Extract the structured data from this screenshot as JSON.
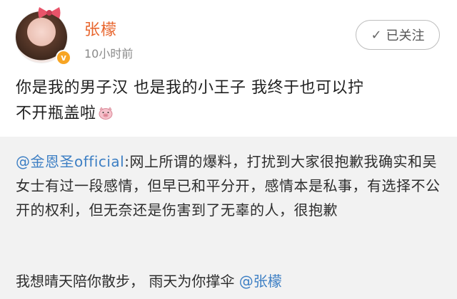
{
  "post": {
    "username": "张檬",
    "time": "10小时前",
    "follow_label": "已关注",
    "verified_badge": "v",
    "content_line1": "你是我的男子汉  也是我的小王子  我终于也可以拧",
    "content_line2": "不开瓶盖啦",
    "content_emoji": "pig-face-icon"
  },
  "repost": {
    "mention": "@金恩圣official",
    "text": ":网上所谓的爆料，打扰到大家很抱歉我确实和吴女士有过一段感情，但早已和平分开，感情本是私事，有选择不公开的权利，但无奈还是伤害到了无辜的人，很抱歉",
    "line2_text": "我想晴天陪你散步，  雨天为你撑伞  ",
    "line2_mention": "@张檬"
  },
  "colors": {
    "username": "#e8652d",
    "mention": "#3d7fc4",
    "repost_bg": "#f2f2f2"
  }
}
